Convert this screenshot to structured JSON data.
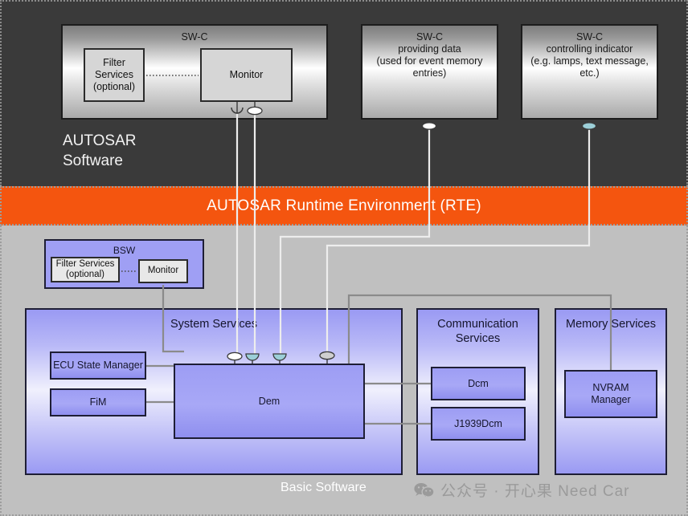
{
  "layers": {
    "application": {
      "label": "AUTOSAR\nSoftware",
      "label_line1": "AUTOSAR",
      "label_line2": "Software",
      "bg": "#3a3a3a"
    },
    "rte": {
      "label": "AUTOSAR Runtime Environment (RTE)",
      "bg": "#f4550f",
      "text_color": "#ffffff"
    },
    "basic_software": {
      "label": "Basic Software",
      "bg": "#c0c0c0",
      "text_color": "#ffffff"
    }
  },
  "swc_components": [
    {
      "id": "swc-monitor",
      "title": "SW-C",
      "children": [
        {
          "id": "filter-services",
          "label": "Filter\nServices\n(optional)",
          "l1": "Filter",
          "l2": "Services",
          "l3": "(optional)"
        },
        {
          "id": "monitor",
          "label": "Monitor"
        }
      ]
    },
    {
      "id": "swc-providing-data",
      "title": "SW-C\nproviding data\n(used for event memory\nentries)",
      "l1": "SW-C",
      "l2": "providing data",
      "l3": "(used for event memory",
      "l4": "entries)"
    },
    {
      "id": "swc-controlling-indicator",
      "title": "SW-C\ncontrolling indicator\n(e.g. lamps, text message,\netc.)",
      "l1": "SW-C",
      "l2": "controlling indicator",
      "l3": "(e.g. lamps, text message,",
      "l4": "etc.)"
    }
  ],
  "bsw_block": {
    "title": "BSW",
    "children": [
      {
        "id": "bsw-filter-services",
        "l1": "Filter Services",
        "l2": "(optional)"
      },
      {
        "id": "bsw-monitor",
        "label": "Monitor"
      }
    ]
  },
  "service_clusters": [
    {
      "id": "system-services",
      "title": "System Services",
      "modules": [
        {
          "id": "ecu-state-manager",
          "label": "ECU State Manager"
        },
        {
          "id": "fim",
          "label": "FiM"
        },
        {
          "id": "dem",
          "label": "Dem"
        }
      ]
    },
    {
      "id": "communication-services",
      "title_l1": "Communication",
      "title_l2": "Services",
      "modules": [
        {
          "id": "dcm",
          "label": "Dcm"
        },
        {
          "id": "j1939dcm",
          "label": "J1939Dcm"
        }
      ]
    },
    {
      "id": "memory-services",
      "title": "Memory Services",
      "modules": [
        {
          "id": "nvram-manager",
          "l1": "NVRAM",
          "l2": "Manager"
        }
      ]
    }
  ],
  "watermark": {
    "text": "公众号 · 开心果 Need Car",
    "icon": "wechat-icon",
    "color": "#9a9a9a"
  },
  "colors": {
    "application_bg": "#3a3a3a",
    "rte_orange": "#f4550f",
    "basic_software_bg": "#c0c0c0",
    "module_blue": "#9a9af3",
    "wire_white": "#ededed",
    "wire_gray": "#8b8b8b",
    "port_teal": "#9ccfd8"
  }
}
